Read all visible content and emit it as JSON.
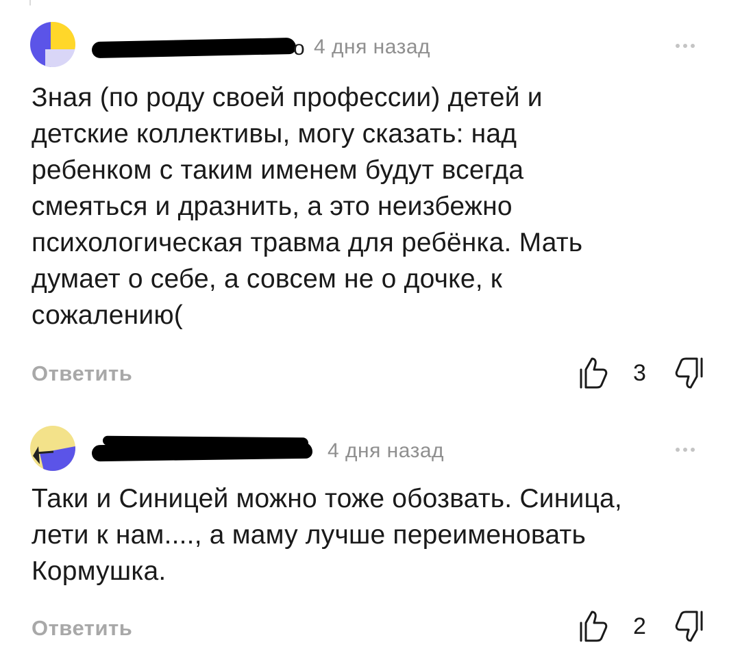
{
  "comments": [
    {
      "author_visible_tail": "о",
      "time": "4 дня назад",
      "text": "Зная (по роду своей профессии) детей и\nдетские коллективы, могу сказать: над\nребенком с таким именем будут всегда\nсмеяться и дразнить, а это неизбежно\nпсихологическая травма для ребёнка. Мать\nдумает о себе, а совсем не о дочке, к\nсожалению(",
      "reply_label": "Ответить",
      "likes": "3",
      "avatar_colors": [
        "#ffd72a",
        "#5b54e8",
        "#d9d6f7"
      ]
    },
    {
      "time": "4 дня назад",
      "text": "Таки и Синицей можно тоже обозвать. Синица,\nлети к нам...., а маму лучше переименовать\nКормушка.",
      "reply_label": "Ответить",
      "likes": "2",
      "avatar_colors": [
        "#f3e28a",
        "#5b54e8",
        "#222222"
      ]
    }
  ],
  "icons": {
    "like": "thumbs-up-outline-icon",
    "dislike": "thumbs-down-outline-icon",
    "more": "more-dots-icon"
  },
  "colors": {
    "text": "#1a1a1a",
    "muted": "#8f8f8f",
    "reply": "#a8a8a8",
    "accent": "#5b54e8"
  }
}
